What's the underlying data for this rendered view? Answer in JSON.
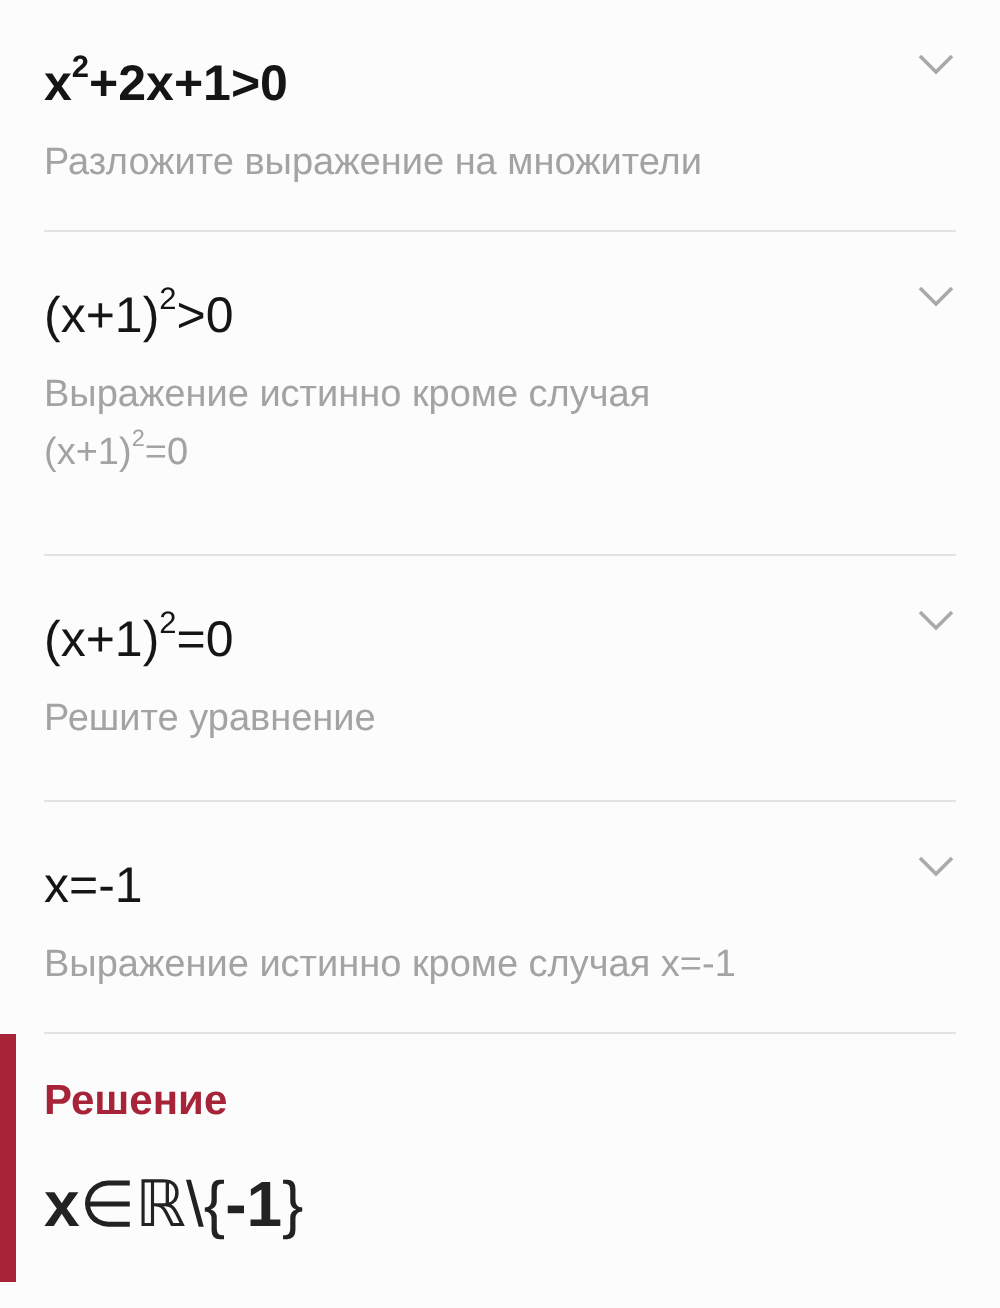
{
  "steps": [
    {
      "expression": "x$^{2}$+2x+1>0",
      "bold": true,
      "expanded": false,
      "hint": "Разложите выражение на множители"
    },
    {
      "expression": "(x+1)$^{2}$>0",
      "bold": false,
      "expanded": false,
      "hint": "Выражение истинно кроме случая",
      "hint_formula": "(x+1)$^{2}$=0"
    },
    {
      "expression": "(x+1)$^{2}$=0",
      "bold": false,
      "expanded": false,
      "hint": "Решите уравнение"
    },
    {
      "expression": "x=-1",
      "bold": false,
      "expanded": false,
      "hint": "Выражение истинно кроме случая x=-1"
    }
  ],
  "solution": {
    "title": "Решение",
    "answer": "**x**∈ℝ\\{**-1**}"
  }
}
